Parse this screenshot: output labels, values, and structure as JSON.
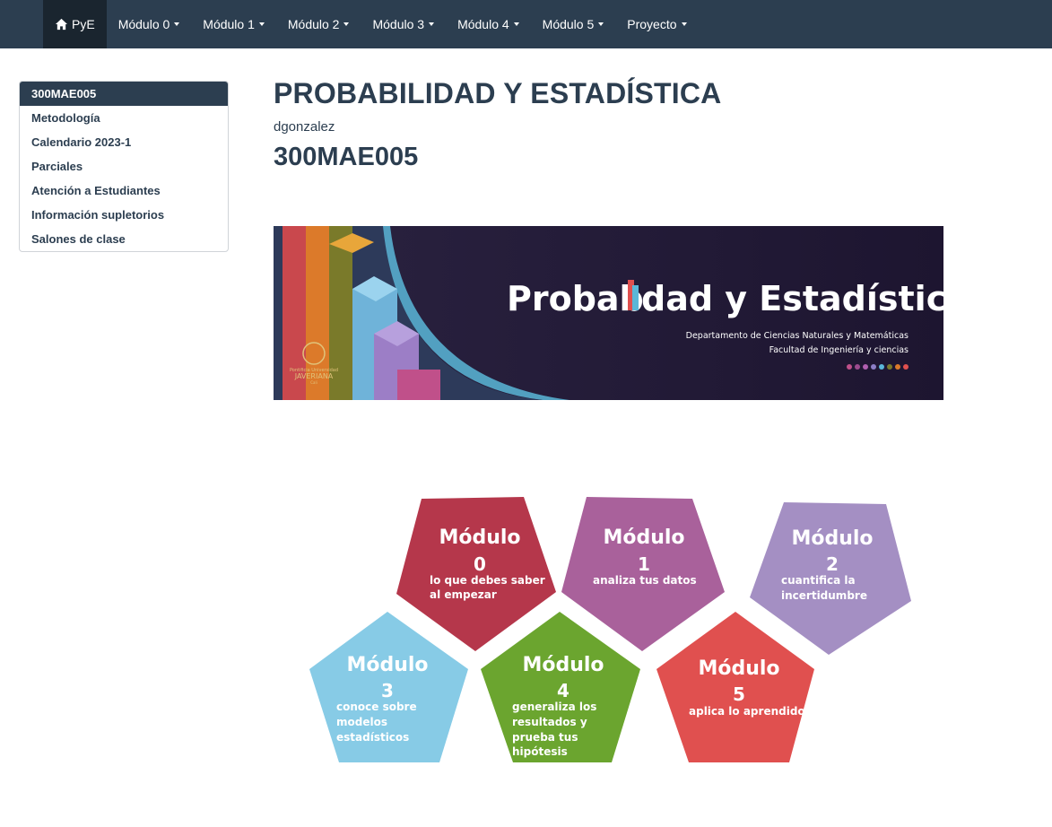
{
  "navbar": {
    "home_label": "PyE",
    "items": [
      {
        "label": "Módulo 0"
      },
      {
        "label": "Módulo 1"
      },
      {
        "label": "Módulo 2"
      },
      {
        "label": "Módulo 3"
      },
      {
        "label": "Módulo 4"
      },
      {
        "label": "Módulo 5"
      },
      {
        "label": "Proyecto"
      }
    ]
  },
  "toc": {
    "items": [
      {
        "label": "300MAE005",
        "active": true
      },
      {
        "label": "Metodología"
      },
      {
        "label": "Calendario 2023-1"
      },
      {
        "label": "Parciales"
      },
      {
        "label": "Atención a Estudiantes"
      },
      {
        "label": "Información supletorios"
      },
      {
        "label": "Salones de clase"
      }
    ]
  },
  "main": {
    "title": "PROBABILIDAD Y ESTADÍSTICA",
    "author": "dgonzalez",
    "subtitle": "300MAE005"
  },
  "banner": {
    "title_left": "Probab",
    "title_right": "dad y Estadística",
    "line1": "Departamento de Ciencias Naturales y Matemáticas",
    "line2": "Facultad de Ingeniería y ciencias",
    "logo_top": "Pontificia Universidad",
    "logo_main": "JAVERIANA",
    "logo_bottom": "Cali"
  },
  "modules": {
    "heading": "Módulo",
    "items": [
      {
        "num": "0",
        "desc1": "lo que debes saber",
        "desc2": "al empezar",
        "color": "#b5374b"
      },
      {
        "num": "1",
        "desc1": "analiza tus datos",
        "desc2": "",
        "color": "#a9619b"
      },
      {
        "num": "2",
        "desc1": "cuantifica la",
        "desc2": "incertidumbre",
        "color": "#a48fc3"
      },
      {
        "num": "3",
        "desc1": "conoce sobre",
        "desc2": "modelos",
        "desc3": "estadísticos",
        "color": "#87cbe6"
      },
      {
        "num": "4",
        "desc1": "generaliza los",
        "desc2": "resultados y",
        "desc3": "prueba tus",
        "desc4": "hipótesis",
        "color": "#6ba52f"
      },
      {
        "num": "5",
        "desc1": "aplica lo aprendido",
        "desc2": "",
        "color": "#e0504f"
      }
    ]
  },
  "colors": {
    "navbar_bg": "#2c3e50",
    "navbar_active": "#1a252f",
    "text": "#2c3e50",
    "banner_bg": "#20172f"
  }
}
